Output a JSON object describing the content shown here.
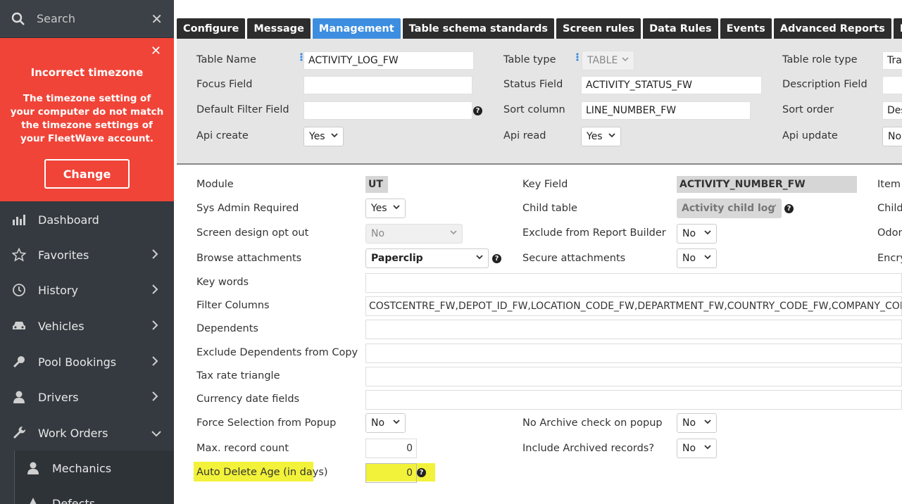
{
  "sidebar": {
    "search_placeholder": "Search",
    "alert": {
      "title": "Incorrect timezone",
      "message": "The timezone setting of your computer do not match the timezone settings of your FleetWave account.",
      "button": "Change"
    },
    "items": [
      {
        "label": "Dashboard",
        "icon": "chart-icon"
      },
      {
        "label": "Favorites",
        "icon": "star-icon"
      },
      {
        "label": "History",
        "icon": "clock-icon"
      },
      {
        "label": "Vehicles",
        "icon": "car-icon"
      },
      {
        "label": "Pool Bookings",
        "icon": "key-icon"
      },
      {
        "label": "Drivers",
        "icon": "user-icon"
      },
      {
        "label": "Work Orders",
        "icon": "wrench-icon"
      }
    ],
    "subitems": [
      {
        "label": "Mechanics",
        "icon": "user-icon"
      },
      {
        "label": "Defects",
        "icon": "warning-icon"
      }
    ]
  },
  "tabs": [
    "Configure",
    "Message",
    "Management",
    "Table schema standards",
    "Screen rules",
    "Data Rules",
    "Events",
    "Advanced Reports",
    "Encryp"
  ],
  "active_tab": "Management",
  "header_form": {
    "table_name_label": "Table Name",
    "table_name": "ACTIVITY_LOG_FW",
    "table_type_label": "Table type",
    "table_type": "TABLE",
    "table_role_label": "Table role type",
    "table_role": "Tra",
    "focus_label": "Focus Field",
    "focus": "",
    "status_label": "Status Field",
    "status": "ACTIVITY_STATUS_FW",
    "description_label": "Description Field",
    "default_filter_label": "Default Filter Field",
    "default_filter": "",
    "sort_column_label": "Sort column",
    "sort_column": "LINE_NUMBER_FW",
    "sort_order_label": "Sort order",
    "sort_order": "Des",
    "api_create_label": "Api create",
    "api_create": "Yes",
    "api_read_label": "Api read",
    "api_read": "Yes",
    "api_update_label": "Api update",
    "api_update": "No"
  },
  "mgmt": {
    "module_label": "Module",
    "module": "UT",
    "key_field_label": "Key Field",
    "key_field": "ACTIVITY_NUMBER_FW",
    "item_label": "Item",
    "sys_admin_label": "Sys Admin Required",
    "sys_admin": "Yes",
    "child_table_label": "Child table",
    "child_table": "Activity child log",
    "child_label": "Child",
    "screen_opt_label": "Screen design opt out",
    "screen_opt": "No",
    "exclude_report_label": "Exclude from Report Builder",
    "exclude_report": "No",
    "odon_label": "Odon",
    "browse_label": "Browse attachments",
    "browse": "Paperclip",
    "secure_label": "Secure attachments",
    "secure": "No",
    "encry_label": "Encry",
    "key_words_label": "Key words",
    "key_words": "",
    "filter_columns_label": "Filter Columns",
    "filter_columns": "COSTCENTRE_FW,DEPOT_ID_FW,LOCATION_CODE_FW,DEPARTMENT_FW,COUNTRY_CODE_FW,COMPANY_CODE_FW",
    "dependents_label": "Dependents",
    "dependents": "",
    "exclude_dep_label": "Exclude Dependents from Copy",
    "exclude_dep": "",
    "tax_label": "Tax rate triangle",
    "tax": "",
    "currency_label": "Currency date fields",
    "currency": "",
    "force_label": "Force Selection from Popup",
    "force": "No",
    "no_archive_label": "No Archive check on popup",
    "no_archive": "No",
    "max_label": "Max. record count",
    "max": "0",
    "include_arch_label": "Include Archived records?",
    "include_arch": "No",
    "auto_delete_label": "Auto Delete Age (in days)",
    "auto_delete": "0"
  },
  "colors": {
    "sidebar_bg": "#343a40",
    "alert_bg": "#f04438",
    "active_tab": "#3d8ee0",
    "highlight": "#f2f23a"
  }
}
